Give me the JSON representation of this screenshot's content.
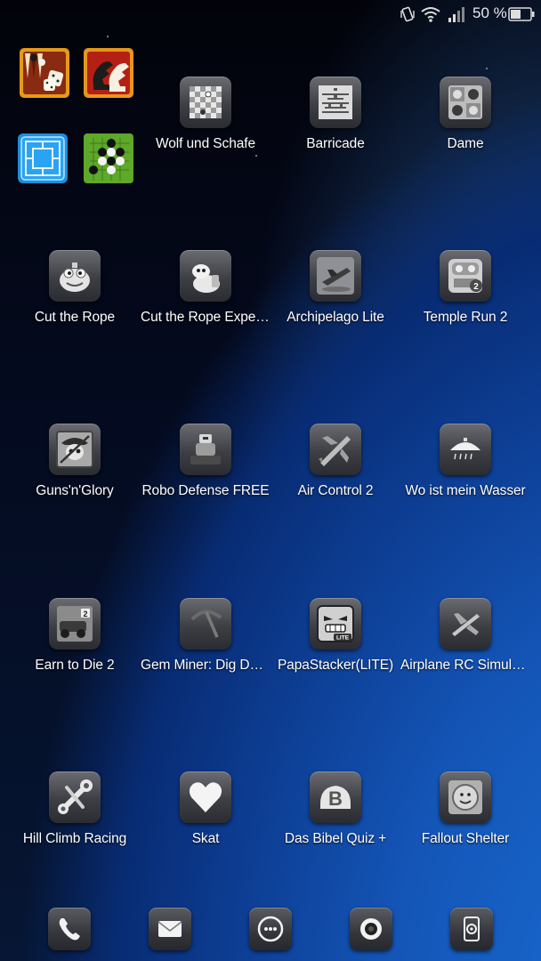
{
  "status_bar": {
    "battery_text": "50 %",
    "icons": [
      "vibrate-icon",
      "wifi-icon",
      "signal-icon",
      "battery-icon"
    ]
  },
  "folders": [
    {
      "icon": "backgammon-icon"
    },
    {
      "icon": "chess-icon"
    },
    {
      "icon": "mill-board-icon"
    },
    {
      "icon": "go-board-icon"
    }
  ],
  "apps": [
    {
      "label": "Wolf und Schafe",
      "icon": "checkerboard-icon"
    },
    {
      "label": "Barricade",
      "icon": "barricade-board-icon"
    },
    {
      "label": "Dame",
      "icon": "dame-board-icon"
    },
    {
      "label": "Cut the Rope",
      "icon": "om-nom-icon"
    },
    {
      "label": "Cut the Rope Experi…",
      "icon": "om-nom-experiments-icon"
    },
    {
      "label": "Archipelago Lite",
      "icon": "plane-island-icon"
    },
    {
      "label": "Temple Run 2",
      "icon": "temple-run-icon"
    },
    {
      "label": "Guns'n'Glory",
      "icon": "cowboy-skull-icon"
    },
    {
      "label": "Robo Defense FREE",
      "icon": "robot-icon"
    },
    {
      "label": "Air Control 2",
      "icon": "airplane-icon"
    },
    {
      "label": "Wo ist mein Wasser",
      "icon": "shower-icon"
    },
    {
      "label": "Earn to Die 2",
      "icon": "car-zombie-icon"
    },
    {
      "label": "Gem Miner: Dig De…",
      "icon": "pickaxe-icon"
    },
    {
      "label": "PapaStacker(LITE)",
      "icon": "angry-block-icon"
    },
    {
      "label": "Airplane RC Simulat…",
      "icon": "rc-plane-icon"
    },
    {
      "label": "Hill Climb Racing",
      "icon": "wrench-icon"
    },
    {
      "label": "Skat",
      "icon": "heart-icon"
    },
    {
      "label": "Das Bibel Quiz +",
      "icon": "bible-b-icon"
    },
    {
      "label": "Fallout Shelter",
      "icon": "vault-boy-icon"
    }
  ],
  "dock": [
    {
      "icon": "phone-icon"
    },
    {
      "icon": "mail-icon"
    },
    {
      "icon": "app-drawer-icon"
    },
    {
      "icon": "camera-icon"
    },
    {
      "icon": "browser-icon"
    }
  ]
}
